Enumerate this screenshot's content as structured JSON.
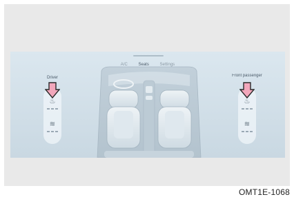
{
  "tabs": [
    {
      "label": "A/C"
    },
    {
      "label": "Seats"
    },
    {
      "label": "Settings"
    }
  ],
  "zones": {
    "driver": {
      "label": "Driver"
    },
    "passenger": {
      "label": "Front passenger"
    }
  },
  "caption": "OMT1E-1068",
  "colors": {
    "highlight_arrow": "#f2a7bb",
    "screen_bg": "#d3e1ea"
  },
  "icons": {
    "driver_top": "seat-heat-icon",
    "driver_bottom": "seat-ventilation-icon",
    "passenger_top": "seat-heat-icon",
    "passenger_bottom": "seat-ventilation-icon",
    "callout": "arrow-down-icon"
  }
}
